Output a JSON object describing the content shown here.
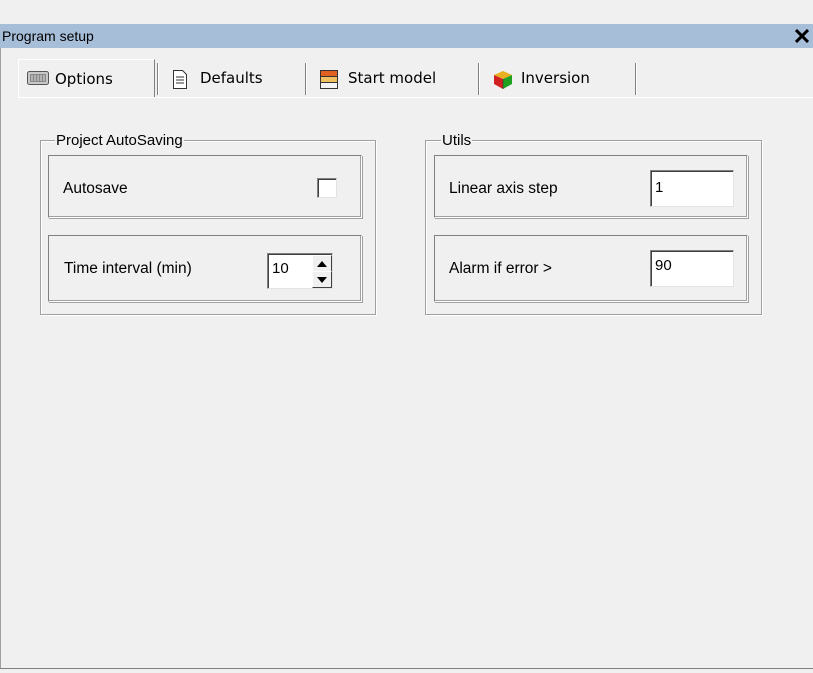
{
  "window": {
    "title": "Program setup",
    "close_glyph": "✕",
    "icon_close": "close-icon"
  },
  "tabs": [
    {
      "label": "Options",
      "icon": "options-icon",
      "active": true
    },
    {
      "label": "Defaults",
      "icon": "document-icon",
      "active": false
    },
    {
      "label": "Start model",
      "icon": "model-icon",
      "active": false
    },
    {
      "label": "Inversion",
      "icon": "cube-icon",
      "active": false
    }
  ],
  "project_autosaving": {
    "title": "Project AutoSaving",
    "autosave_label": "Autosave",
    "autosave_checked": false,
    "interval_label": "Time interval (min)",
    "interval_value": "10"
  },
  "utils": {
    "title": "Utils",
    "linear_step_label": "Linear axis step",
    "linear_step_value": "1",
    "alarm_label": "Alarm if error >",
    "alarm_value": "90"
  },
  "colors": {
    "titlebar": "#a7bed8",
    "face": "#f0f0f0"
  }
}
